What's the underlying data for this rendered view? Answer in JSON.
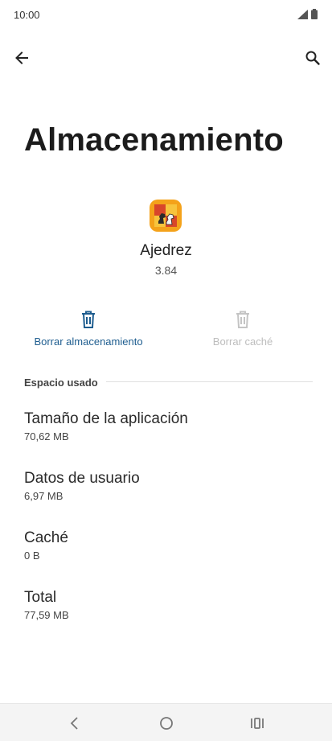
{
  "status_bar": {
    "time": "10:00"
  },
  "page": {
    "title": "Almacenamiento"
  },
  "app": {
    "name": "Ajedrez",
    "version": "3.84"
  },
  "actions": {
    "clear_storage": {
      "label": "Borrar almacenamiento",
      "enabled": true
    },
    "clear_cache": {
      "label": "Borrar caché",
      "enabled": false
    }
  },
  "section": {
    "title": "Espacio usado"
  },
  "storage_items": [
    {
      "title": "Tamaño de la aplicación",
      "value": "70,62 MB"
    },
    {
      "title": "Datos de usuario",
      "value": "6,97 MB"
    },
    {
      "title": "Caché",
      "value": "0 B"
    },
    {
      "title": "Total",
      "value": "77,59 MB"
    }
  ],
  "icons": {
    "back": "arrow-left-icon",
    "search": "search-icon",
    "clear_storage": "trash-icon",
    "clear_cache": "trash-icon",
    "app": "chess-app-icon"
  },
  "colors": {
    "accent": "#1e5d8f",
    "disabled": "#bdbdbd",
    "app_icon_orange": "#f29a17",
    "app_icon_red": "#d8462a"
  }
}
